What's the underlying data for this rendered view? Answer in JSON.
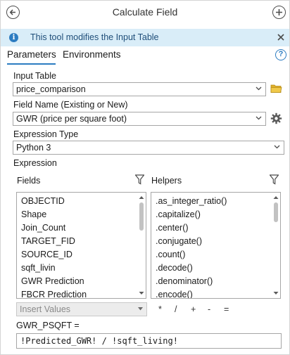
{
  "header": {
    "title": "Calculate Field"
  },
  "banner": {
    "icon": "info-icon",
    "text": "This tool modifies the Input Table"
  },
  "tabs": {
    "parameters": "Parameters",
    "environments": "Environments"
  },
  "input_table": {
    "label": "Input Table",
    "value": "price_comparison"
  },
  "field_name": {
    "label": "Field Name (Existing or New)",
    "value": "GWR (price per square foot)"
  },
  "expression_type": {
    "label": "Expression Type",
    "value": "Python 3"
  },
  "expression": {
    "label": "Expression",
    "fields_label": "Fields",
    "helpers_label": "Helpers",
    "fields": [
      "OBJECTID",
      "Shape",
      "Join_Count",
      "TARGET_FID",
      "SOURCE_ID",
      "sqft_livin",
      "GWR Prediction",
      "FBCR Prediction"
    ],
    "helpers": [
      ".as_integer_ratio()",
      ".capitalize()",
      ".center()",
      ".conjugate()",
      ".count()",
      ".decode()",
      ".denominator()",
      ".encode()"
    ],
    "insert_values_placeholder": "Insert Values",
    "operators": [
      "*",
      "/",
      "+",
      "-",
      "="
    ],
    "target_label": "GWR_PSQFT =",
    "code": "!Predicted_GWR! / !sqft_living!"
  },
  "colors": {
    "accent": "#2c7cc1",
    "banner_bg": "#d9edf8",
    "banner_text": "#1f4e79",
    "folder": "#e0b12b"
  }
}
